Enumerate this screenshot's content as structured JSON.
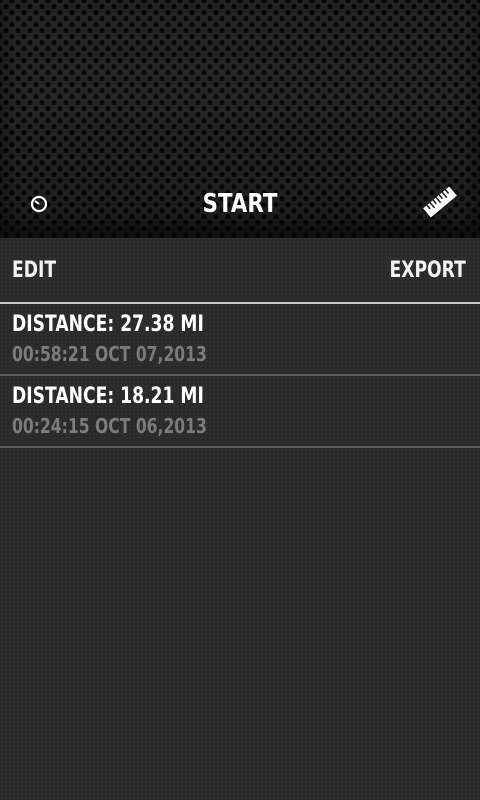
{
  "header": {
    "start_label": "START",
    "timer_icon": "timer-icon",
    "ruler_icon": "ruler-icon"
  },
  "toolbar": {
    "edit_label": "EDIT",
    "export_label": "EXPORT"
  },
  "runs": [
    {
      "distance_label": "DISTANCE: 27.38 MI",
      "meta_label": "00:58:21 OCT 07,2013"
    },
    {
      "distance_label": "DISTANCE: 18.21 MI",
      "meta_label": "00:24:15 OCT 06,2013"
    }
  ],
  "colors": {
    "background": "#2b2b2b",
    "text_primary": "#ffffff",
    "text_secondary": "#7c7c7c",
    "divider": "#c8c8c8"
  }
}
